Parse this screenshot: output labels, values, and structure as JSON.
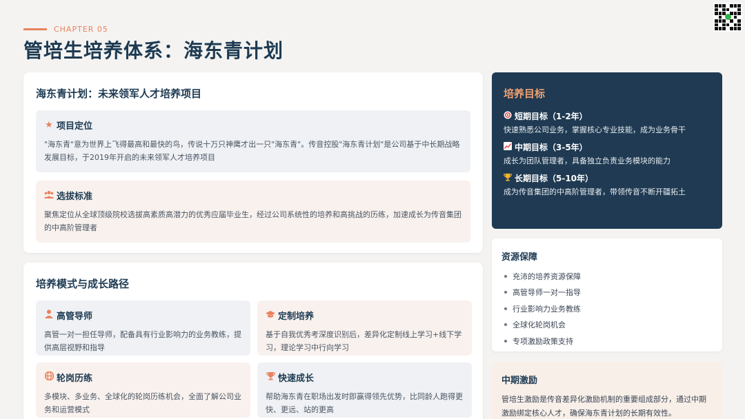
{
  "header": {
    "chapter": "CHAPTER 05",
    "title": "管培生培养体系：海东青计划"
  },
  "main_card": {
    "title": "海东青计划：未来领军人才培养项目",
    "sections": [
      {
        "icon": "star-icon",
        "heading": "项目定位",
        "text": "\"海东青\"意为世界上飞得最高和最快的鸟，传说十万只神鹰才出一只\"海东青\"。传音控股\"海东青计划\"是公司基于中长期战略发展目标，于2019年开启的未来领军人才培养项目"
      },
      {
        "icon": "users-icon",
        "heading": "选拔标准",
        "text": "聚焦定位从全球顶级院校选拔高素质高潜力的优秀应届毕业生，经过公司系统性的培养和高挑战的历练，加速成长为传音集团的中高阶管理者"
      }
    ]
  },
  "path_card": {
    "title": "培养模式与成长路径",
    "items": [
      {
        "icon": "mentor-icon",
        "heading": "高管导师",
        "text": "高管一对一担任导师，配备具有行业影响力的业务教练，提供高层视野和指导"
      },
      {
        "icon": "graduation-cap-icon",
        "heading": "定制培养",
        "text": "基于自我优秀考深度识别后，差异化定制线上学习+线下学习，理论学习中行向学习"
      },
      {
        "icon": "globe-icon",
        "heading": "轮岗历练",
        "text": "多模块、多业务、全球化的轮岗历练机会，全面了解公司业务和运营模式"
      },
      {
        "icon": "trophy-icon",
        "heading": "快速成长",
        "text": "帮助海东青在职场出发时即赢得领先优势，比同龄人跑得更快、更远、站的更高"
      }
    ]
  },
  "goals": {
    "title": "培养目标",
    "items": [
      {
        "icon": "target-icon",
        "heading": "短期目标（1-2年）",
        "text": "快速熟悉公司业务，掌握核心专业技能，成为业务骨干"
      },
      {
        "icon": "chart-up-icon",
        "heading": "中期目标（3-5年）",
        "text": "成长为团队管理者，具备独立负责业务模块的能力"
      },
      {
        "icon": "trophy-icon",
        "heading": "长期目标（5-10年）",
        "text": "成为传音集团的中高阶管理者，带领传音不断开疆拓土"
      }
    ]
  },
  "resources": {
    "title": "资源保障",
    "items": [
      "充沛的培养资源保障",
      "高管导师一对一指导",
      "行业影响力业务教练",
      "全球化轮岗机会",
      "专项激励政策支持"
    ]
  },
  "incentive": {
    "title": "中期激励",
    "text": "管培生激励是传音差异化激励机制的重要组成部分，通过中期激励绑定核心人才，确保海东青计划的长期有效性。"
  },
  "colors": {
    "accent": "#e8825d",
    "navy": "#1f3a52",
    "goal_title": "#f0a071"
  }
}
